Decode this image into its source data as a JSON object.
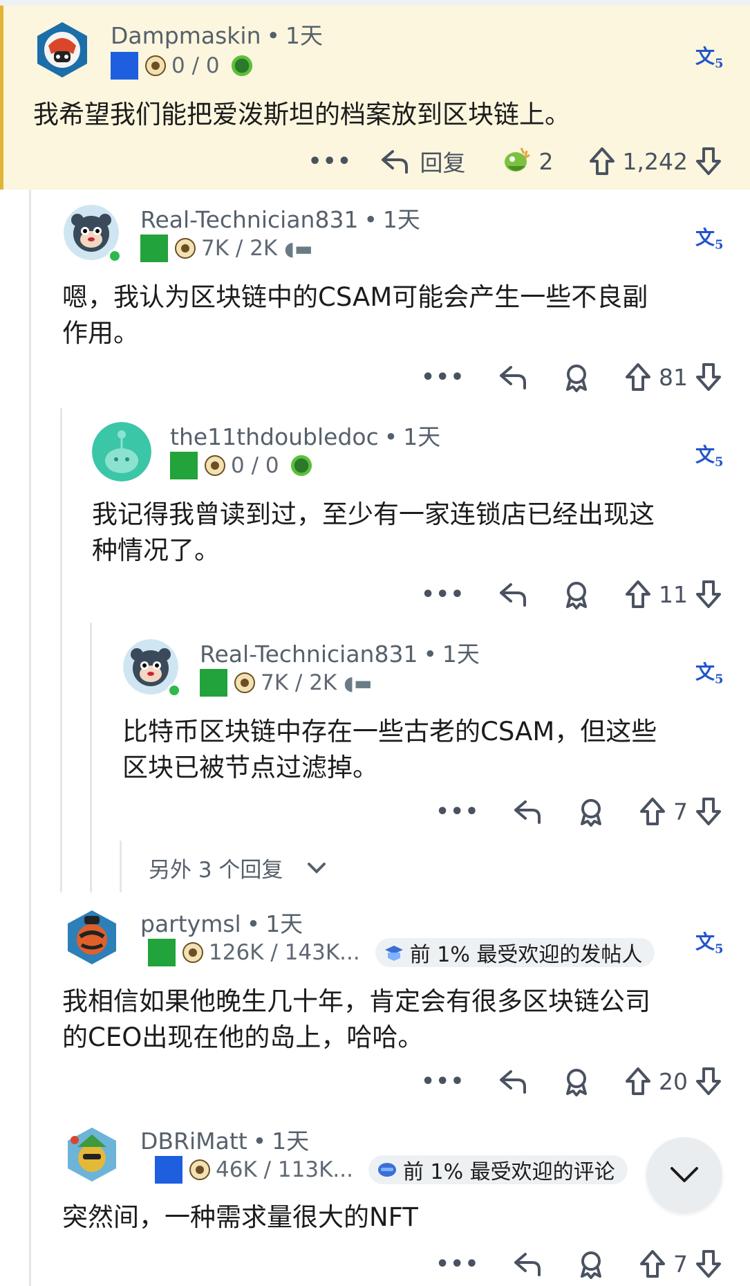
{
  "comments": [
    {
      "username": "Dampmaskin",
      "time": "1天",
      "flair_text": "0 / 0",
      "body": "我希望我们能把爱泼斯坦的档案放到区块链上。",
      "reply_label": "回复",
      "award_count": "2",
      "score": "1,242"
    },
    {
      "username": "Real-Technician831",
      "time": "1天",
      "flair_text": "7K / 2K",
      "body_line1": "嗯，我认为区块链中的CSAM可能会产生一些不良副",
      "body_line2": "作用。",
      "score": "81"
    },
    {
      "username": "the11thdoubledoc",
      "time": "1天",
      "flair_text": "0 / 0",
      "body_line1": "我记得我曾读到过，至少有一家连锁店已经出现这",
      "body_line2": "种情况了。",
      "score": "11"
    },
    {
      "username": "Real-Technician831",
      "time": "1天",
      "flair_text": "7K / 2K",
      "body_line1": "比特币区块链中存在一些古老的CSAM，但这些",
      "body_line2": "区块已被节点过滤掉。",
      "score": "7"
    },
    {
      "username": "partymsl",
      "time": "1天",
      "flair_text": "126K / 143K...",
      "badge": "前 1% 最受欢迎的发帖人",
      "body_line1": "我相信如果他晚生几十年，肯定会有很多区块链公司",
      "body_line2": "的CEO出现在他的岛上，哈哈。",
      "score": "20"
    },
    {
      "username": "DBRiMatt",
      "time": "1天",
      "flair_text": "46K / 113K...",
      "badge": "前 1% 最受欢迎的评论",
      "body": "突然间，一种需求量很大的NFT",
      "score": "7"
    }
  ],
  "more_replies_label": "另外 3 个回复",
  "colors": {
    "highlight_bg": "#fbf6dd",
    "highlight_border": "#e2b436",
    "link_blue": "#2255cc",
    "online": "#2fb94d"
  },
  "icons": [
    "translate-icon",
    "more-icon",
    "reply-icon",
    "award-icon",
    "upvote-icon",
    "downvote-icon",
    "chevron-down-icon"
  ]
}
